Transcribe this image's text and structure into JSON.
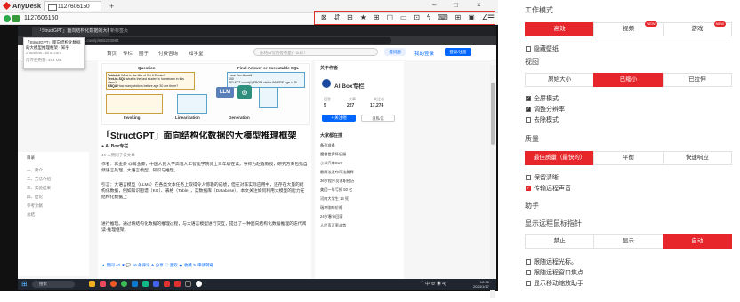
{
  "window": {
    "app_name": "AnyDesk",
    "tab_label": "1127606150",
    "new_tab": "+",
    "minimize": "–",
    "maximize": "□",
    "close": "×"
  },
  "address": {
    "id": "1127606150"
  },
  "toolbar_icons": [
    "monitor-icon",
    "transfer-icon",
    "clipboard-icon",
    "star-icon",
    "screenshot-icon",
    "split-view-icon",
    "chat-icon",
    "whiteboard-icon",
    "lightning-icon",
    "keyboard-icon",
    "window-icon",
    "fit-icon",
    "pen-icon",
    "grid-icon"
  ],
  "remote": {
    "chrome_tab": "「StructGPT」面向结构化数据的大模型推",
    "chrome_tab2": "新标签页",
    "url": "zhuanlan.zhihu.com/p/665203982",
    "popup_title": "「StructGPT」面向结构化数据的大模型推理框架 - 知乎",
    "popup_url": "zhuanlan.zhihu.com",
    "popup_mem": "内存使用量: 194 MB",
    "nav": [
      "首页",
      "专栏",
      "圈子",
      "付费咨询",
      "知学堂"
    ],
    "search_placeholder": "你的AI写的答卷是什么样？",
    "ask": "提问题",
    "login": "我的登录",
    "register": "登录/注册",
    "figure": {
      "question_label": "Question",
      "q_lines": [
        "What is the title of Sci-fi Poster?",
        "what is the last student's hometown in this class?",
        "How many visitors before age 30 are there?"
      ],
      "q_kinds": [
        "TableQA",
        "Text-to-SQL",
        "KBQA"
      ],
      "answer_label": "Final Answer or Executable SQL",
      "answer_lines": [
        "Lane Yao Howell",
        "100",
        "SELECT count(*) FROM visitor WHERE age < 30"
      ],
      "invoking_label": "Invoking",
      "linearization_label": "Linearization",
      "generation_label": "Generation",
      "llm": "LLM",
      "gpt_icon": "⊛"
    },
    "title": "「StructGPT」面向结构化数据的大模型推理框架",
    "author": "AI Box专栏",
    "meta": "40 人赞同了该文章",
    "paragraphs": [
      "作者：蒋金豪 @蒋金豪，中国人民大学高瓴人工智能学院博士三年级在读，导师为赵鑫教授，研究方向包括自然语言处理、大语言模型、知识与推理。",
      "引言：大语言模型（LLMs）在各类文本任务上取得令人惊艳的成绩，但在对非实际应用中，还存在大量的结构化数据，例如知识图谱（KG）、表格（Table），实数据库（Database）。本文关注如何利用大模型的能力在结构化数据上",
      "进行推理。通过将结构化数据的推理过程，与大语言模型进行交互，提出了一种面向结构化数据推理的迭代阅读-推理框架。"
    ],
    "actions": "▲ 赞同 40   ▼   💬 16 条评论   ✈ 分享   ♡ 喜欢   ★ 收藏   ✎ 申请转载",
    "side_left": [
      "目录",
      "一、简介",
      "二、方法介绍",
      "三、实验结果",
      "四、结论",
      "参考文献",
      "总结"
    ],
    "side_right": {
      "about": "关于作者",
      "author": "AI Box专栏",
      "stats_labels": [
        "回答",
        "文章",
        "关注者"
      ],
      "stats": [
        "5",
        "227",
        "17,274"
      ],
      "follow": "+ 关注他",
      "message": "发私信",
      "hot_title": "大家都在搜",
      "hot": [
        "备孕准备",
        "魔兽世界怀旧服",
        "小米汽车SU7",
        "最高法发布司法解释",
        "36岁程序员求职经历",
        "美团一年亏损 50 亿",
        "河南大学生 13 死",
        "瑞幸咖啡价格",
        "24岁春节回家",
        "人民币汇率走势"
      ]
    },
    "taskbar": {
      "start": "⊞",
      "search": "搜索",
      "tray": "ˆ 中 ⊕ ◉ 4)",
      "time": "12:06",
      "date": "2024/1/17"
    }
  },
  "settings": {
    "mode_title": "工作模式",
    "modes": [
      {
        "label": "高效",
        "on": true,
        "badge": ""
      },
      {
        "label": "视频",
        "on": false,
        "badge": "NEW"
      },
      {
        "label": "游戏",
        "on": false,
        "badge": "NEW"
      }
    ],
    "hide_wallpaper": "隐藏壁纸",
    "view_title": "视图",
    "views": [
      {
        "label": "原始大小",
        "on": false
      },
      {
        "label": "已缩小",
        "on": true
      },
      {
        "label": "已拉伸",
        "on": false
      }
    ],
    "view_checks": [
      {
        "label": "全屏模式",
        "checked": true
      },
      {
        "label": "调整分辨率",
        "checked": true
      },
      {
        "label": "去除模式",
        "checked": false
      }
    ],
    "quality_title": "质量",
    "qualities": [
      {
        "label": "最佳质量（最快的）",
        "on": true
      },
      {
        "label": "平衡",
        "on": false
      },
      {
        "label": "快速响应",
        "on": false
      }
    ],
    "quality_checks": [
      {
        "label": "保留清晰",
        "checked": false
      },
      {
        "label": "传输远程声音",
        "checked": true
      }
    ],
    "assist_title": "助手",
    "cursor_title": "显示远程鼠标指针",
    "cursors": [
      {
        "label": "禁止",
        "on": false
      },
      {
        "label": "显示",
        "on": false
      },
      {
        "label": "自动",
        "on": true
      }
    ],
    "bottom_checks": [
      {
        "label": "跟随远程光标。",
        "checked": false
      },
      {
        "label": "跟随远程窗口焦点",
        "checked": false
      },
      {
        "label": "显示移动缩放助手",
        "checked": false
      }
    ],
    "accent": "#e6262a"
  }
}
